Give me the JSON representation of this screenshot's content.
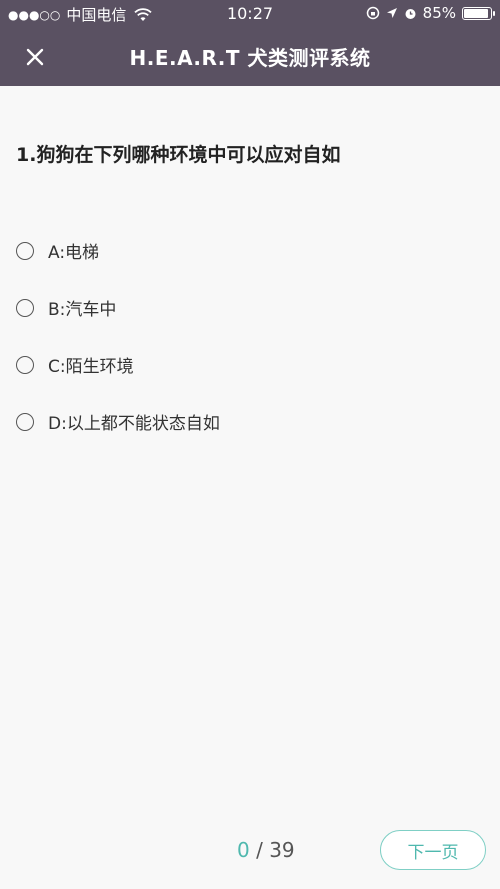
{
  "status_bar": {
    "signal_dots": "●●●○○",
    "carrier": "中国电信",
    "time": "10:27",
    "battery_percent": "85%",
    "battery_level": 0.85
  },
  "header": {
    "title": "H.E.A.R.T 犬类测评系统",
    "background_color": "#5a5162"
  },
  "question": {
    "text": "1.狗狗在下列哪种环境中可以应对自如",
    "options": [
      {
        "label": "A:电梯"
      },
      {
        "label": "B:汽车中"
      },
      {
        "label": "C:陌生环境"
      },
      {
        "label": "D:以上都不能状态自如"
      }
    ]
  },
  "footer": {
    "current": "0",
    "separator": " / ",
    "total": "39",
    "next_label": "下一页",
    "accent_color": "#4fb8ae"
  }
}
